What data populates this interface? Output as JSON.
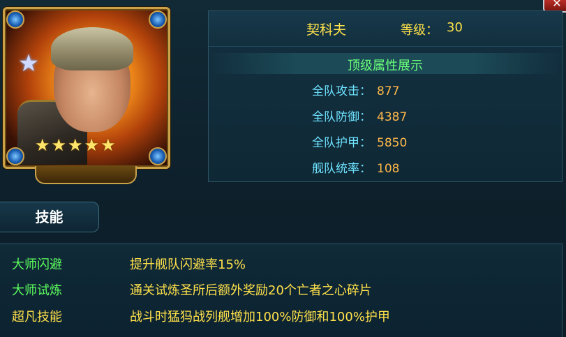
{
  "hero": {
    "name": "契科夫",
    "level_label": "等级：",
    "level_value": "30",
    "stars": 5,
    "rank_icon": "chevron-rank-icon"
  },
  "attributes": {
    "section_title": "顶级属性展示",
    "rows": [
      {
        "label": "全队攻击：",
        "value": "877"
      },
      {
        "label": "全队防御：",
        "value": "4387"
      },
      {
        "label": "全队护甲：",
        "value": "5850"
      },
      {
        "label": "舰队统率：",
        "value": "108"
      }
    ]
  },
  "tab": {
    "label": "技能"
  },
  "skills": [
    {
      "name": "大师闪避",
      "desc": "提升舰队闪避率15%",
      "color": "#5dff5d"
    },
    {
      "name": "大师试炼",
      "desc": "通关试炼圣所后额外奖励20个亡者之心碎片",
      "color": "#5dff5d"
    },
    {
      "name": "超凡技能",
      "desc": "战斗时猛犸战列舰增加100%防御和100%护甲",
      "color": "#ffe14a"
    }
  ],
  "colors": {
    "gold": "#ffe14a",
    "green": "#6aff7a",
    "cyan": "#6ee3ff",
    "orange": "#ffb84a"
  }
}
